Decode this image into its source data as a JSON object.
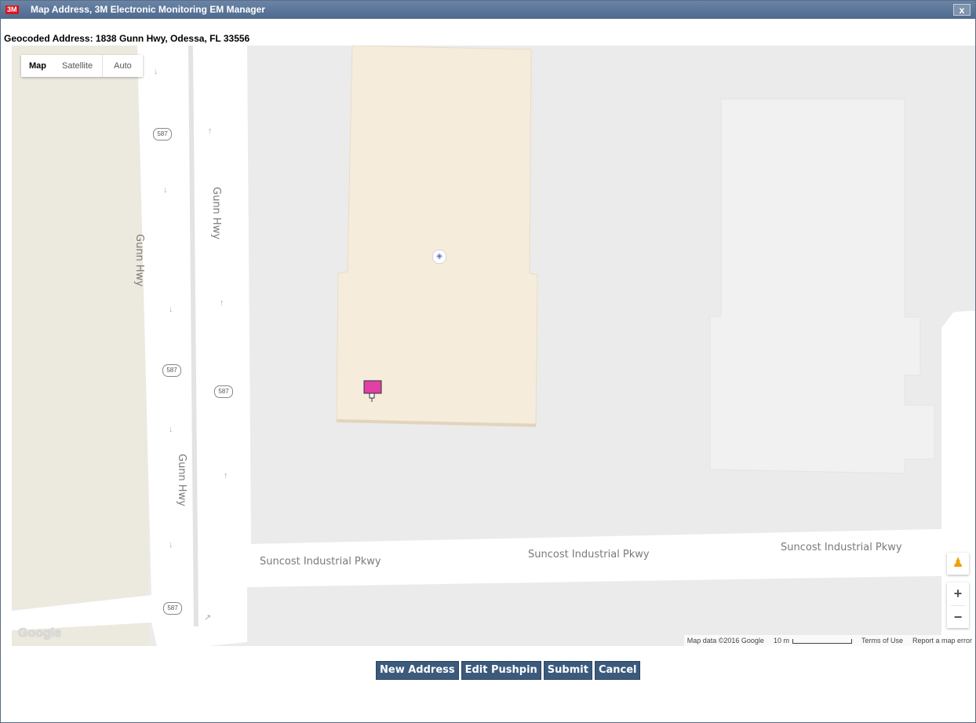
{
  "window": {
    "logo_text": "3M",
    "title": "Map Address, 3M Electronic Monitoring EM Manager",
    "close_label": "x"
  },
  "geocoded": {
    "text": "Geocoded Address: 1838 Gunn Hwy, Odessa, FL 33556"
  },
  "map": {
    "map_type": {
      "map": "Map",
      "satellite": "Satellite",
      "auto": "Auto"
    },
    "streets": {
      "gunn_hwy": "Gunn Hwy",
      "suncoast": "Suncost Industrial Pkwy"
    },
    "route_shield": "587",
    "google_logo": "Google",
    "attribution": {
      "map_data": "Map data ©2016 Google",
      "scale": "10 m",
      "terms": "Terms of Use",
      "report": "Report a map error"
    },
    "zoom_in": "+",
    "zoom_out": "−",
    "pegman_icon": "pegman-icon",
    "pushpin_color": "#e03fa6",
    "building_color": "#f5ecdc"
  },
  "buttons": {
    "new_address": "New Address",
    "edit_pushpin": "Edit Pushpin",
    "submit": "Submit",
    "cancel": "Cancel"
  }
}
